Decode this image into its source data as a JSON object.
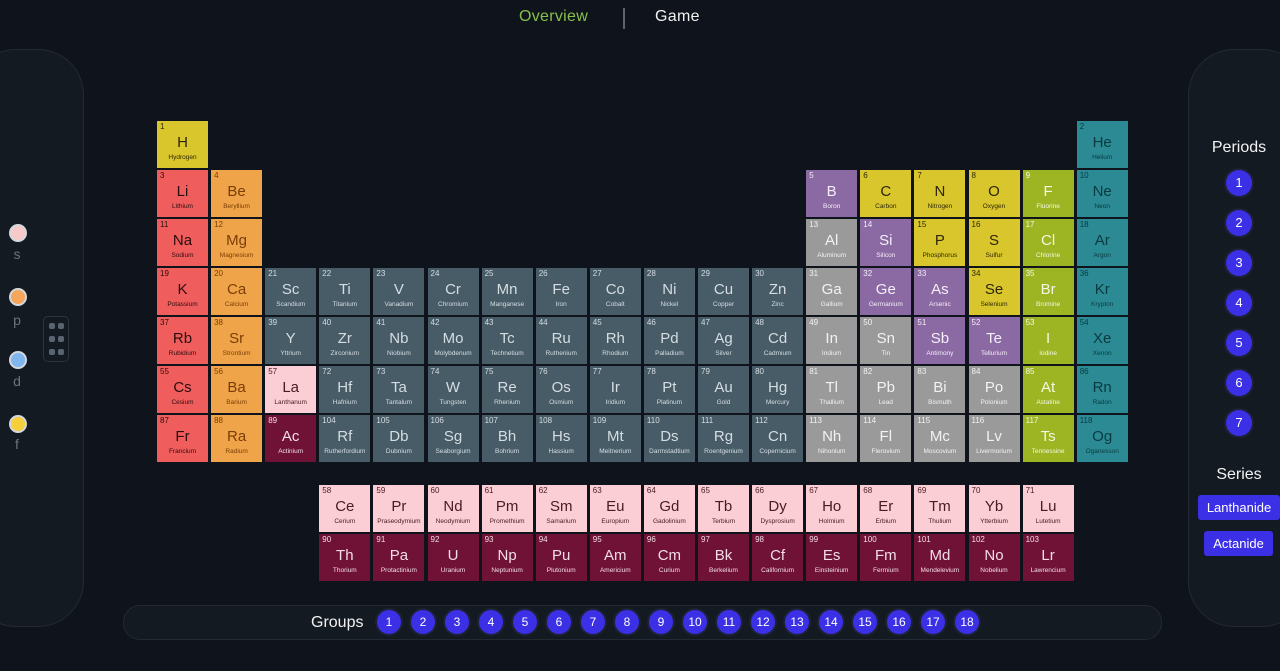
{
  "nav": {
    "overview": "Overview",
    "game": "Game"
  },
  "block_filters": [
    {
      "label": "s",
      "color": "#f7c9c9"
    },
    {
      "label": "p",
      "color": "#f5a65a"
    },
    {
      "label": "d",
      "color": "#7fb6ee"
    },
    {
      "label": "f",
      "color": "#f5cf3c"
    }
  ],
  "periods": {
    "title": "Periods",
    "items": [
      "1",
      "2",
      "3",
      "4",
      "5",
      "6",
      "7"
    ]
  },
  "series": {
    "title": "Series",
    "lanthanide": "Lanthanide",
    "actanide": "Actanide"
  },
  "groups": {
    "label": "Groups",
    "items": [
      "1",
      "2",
      "3",
      "4",
      "5",
      "6",
      "7",
      "8",
      "9",
      "10",
      "11",
      "12",
      "13",
      "14",
      "15",
      "16",
      "17",
      "18"
    ]
  },
  "categories": {
    "alkali": {
      "bg": "#f05d5d",
      "fg": "#2a0d0d"
    },
    "alkaline": {
      "bg": "#f0a44a",
      "fg": "#7a3d05"
    },
    "transition": {
      "bg": "#485c67",
      "fg": "#d5dde3"
    },
    "post": {
      "bg": "#9a9a9a",
      "fg": "#f2f2f2"
    },
    "metalloid": {
      "bg": "#8b6aa3",
      "fg": "#f5eef9"
    },
    "nonmetal": {
      "bg": "#d8c62c",
      "fg": "#2e2608"
    },
    "halogen": {
      "bg": "#9db423",
      "fg": "#f4f8e2"
    },
    "noble": {
      "bg": "#2b8a94",
      "fg": "#0a3a40"
    },
    "lanth": {
      "bg": "#fbcdd4",
      "fg": "#4a1a24"
    },
    "actin": {
      "bg": "#6f1236",
      "fg": "#f3dde6"
    }
  },
  "elements": [
    {
      "n": "1",
      "s": "H",
      "name": "Hydrogen",
      "c": "nonmetal"
    },
    {
      "n": "2",
      "s": "He",
      "name": "Helium",
      "c": "noble"
    },
    {
      "n": "3",
      "s": "Li",
      "name": "Lithium",
      "c": "alkali"
    },
    {
      "n": "4",
      "s": "Be",
      "name": "Beryllium",
      "c": "alkaline"
    },
    {
      "n": "5",
      "s": "B",
      "name": "Boron",
      "c": "metalloid"
    },
    {
      "n": "6",
      "s": "C",
      "name": "Carbon",
      "c": "nonmetal"
    },
    {
      "n": "7",
      "s": "N",
      "name": "Nitrogen",
      "c": "nonmetal"
    },
    {
      "n": "8",
      "s": "O",
      "name": "Oxygen",
      "c": "nonmetal"
    },
    {
      "n": "9",
      "s": "F",
      "name": "Fluorine",
      "c": "halogen"
    },
    {
      "n": "10",
      "s": "Ne",
      "name": "Neon",
      "c": "noble"
    },
    {
      "n": "11",
      "s": "Na",
      "name": "Sodium",
      "c": "alkali"
    },
    {
      "n": "12",
      "s": "Mg",
      "name": "Magnesium",
      "c": "alkaline"
    },
    {
      "n": "13",
      "s": "Al",
      "name": "Aluminum",
      "c": "post"
    },
    {
      "n": "14",
      "s": "Si",
      "name": "Silicon",
      "c": "metalloid"
    },
    {
      "n": "15",
      "s": "P",
      "name": "Phosphorus",
      "c": "nonmetal"
    },
    {
      "n": "16",
      "s": "S",
      "name": "Sulfur",
      "c": "nonmetal"
    },
    {
      "n": "17",
      "s": "Cl",
      "name": "Chlorine",
      "c": "halogen"
    },
    {
      "n": "18",
      "s": "Ar",
      "name": "Argon",
      "c": "noble"
    },
    {
      "n": "19",
      "s": "K",
      "name": "Potassium",
      "c": "alkali"
    },
    {
      "n": "20",
      "s": "Ca",
      "name": "Calcium",
      "c": "alkaline"
    },
    {
      "n": "21",
      "s": "Sc",
      "name": "Scandium",
      "c": "transition"
    },
    {
      "n": "22",
      "s": "Ti",
      "name": "Titanium",
      "c": "transition"
    },
    {
      "n": "23",
      "s": "V",
      "name": "Vanadium",
      "c": "transition"
    },
    {
      "n": "24",
      "s": "Cr",
      "name": "Chromium",
      "c": "transition"
    },
    {
      "n": "25",
      "s": "Mn",
      "name": "Manganese",
      "c": "transition"
    },
    {
      "n": "26",
      "s": "Fe",
      "name": "Iron",
      "c": "transition"
    },
    {
      "n": "27",
      "s": "Co",
      "name": "Cobalt",
      "c": "transition"
    },
    {
      "n": "28",
      "s": "Ni",
      "name": "Nickel",
      "c": "transition"
    },
    {
      "n": "29",
      "s": "Cu",
      "name": "Copper",
      "c": "transition"
    },
    {
      "n": "30",
      "s": "Zn",
      "name": "Zinc",
      "c": "transition"
    },
    {
      "n": "31",
      "s": "Ga",
      "name": "Gallium",
      "c": "post"
    },
    {
      "n": "32",
      "s": "Ge",
      "name": "Germanium",
      "c": "metalloid"
    },
    {
      "n": "33",
      "s": "As",
      "name": "Arsenic",
      "c": "metalloid"
    },
    {
      "n": "34",
      "s": "Se",
      "name": "Selenium",
      "c": "nonmetal"
    },
    {
      "n": "35",
      "s": "Br",
      "name": "Bromine",
      "c": "halogen"
    },
    {
      "n": "36",
      "s": "Kr",
      "name": "Krypton",
      "c": "noble"
    },
    {
      "n": "37",
      "s": "Rb",
      "name": "Rubidium",
      "c": "alkali"
    },
    {
      "n": "38",
      "s": "Sr",
      "name": "Strontium",
      "c": "alkaline"
    },
    {
      "n": "39",
      "s": "Y",
      "name": "Yttrium",
      "c": "transition"
    },
    {
      "n": "40",
      "s": "Zr",
      "name": "Zirconium",
      "c": "transition"
    },
    {
      "n": "41",
      "s": "Nb",
      "name": "Niobium",
      "c": "transition"
    },
    {
      "n": "42",
      "s": "Mo",
      "name": "Molybdenum",
      "c": "transition"
    },
    {
      "n": "43",
      "s": "Tc",
      "name": "Technetium",
      "c": "transition"
    },
    {
      "n": "44",
      "s": "Ru",
      "name": "Ruthenium",
      "c": "transition"
    },
    {
      "n": "45",
      "s": "Rh",
      "name": "Rhodium",
      "c": "transition"
    },
    {
      "n": "46",
      "s": "Pd",
      "name": "Palladium",
      "c": "transition"
    },
    {
      "n": "47",
      "s": "Ag",
      "name": "Silver",
      "c": "transition"
    },
    {
      "n": "48",
      "s": "Cd",
      "name": "Cadmium",
      "c": "transition"
    },
    {
      "n": "49",
      "s": "In",
      "name": "Indium",
      "c": "post"
    },
    {
      "n": "50",
      "s": "Sn",
      "name": "Tin",
      "c": "post"
    },
    {
      "n": "51",
      "s": "Sb",
      "name": "Antimony",
      "c": "metalloid"
    },
    {
      "n": "52",
      "s": "Te",
      "name": "Tellurium",
      "c": "metalloid"
    },
    {
      "n": "53",
      "s": "I",
      "name": "Iodine",
      "c": "halogen"
    },
    {
      "n": "54",
      "s": "Xe",
      "name": "Xenon",
      "c": "noble"
    },
    {
      "n": "55",
      "s": "Cs",
      "name": "Cesium",
      "c": "alkali"
    },
    {
      "n": "56",
      "s": "Ba",
      "name": "Barium",
      "c": "alkaline"
    },
    {
      "n": "57",
      "s": "La",
      "name": "Lanthanum",
      "c": "lanth"
    },
    {
      "n": "72",
      "s": "Hf",
      "name": "Hafnium",
      "c": "transition"
    },
    {
      "n": "73",
      "s": "Ta",
      "name": "Tantalum",
      "c": "transition"
    },
    {
      "n": "74",
      "s": "W",
      "name": "Tungsten",
      "c": "transition"
    },
    {
      "n": "75",
      "s": "Re",
      "name": "Rhenium",
      "c": "transition"
    },
    {
      "n": "76",
      "s": "Os",
      "name": "Osmium",
      "c": "transition"
    },
    {
      "n": "77",
      "s": "Ir",
      "name": "Iridium",
      "c": "transition"
    },
    {
      "n": "78",
      "s": "Pt",
      "name": "Platinum",
      "c": "transition"
    },
    {
      "n": "79",
      "s": "Au",
      "name": "Gold",
      "c": "transition"
    },
    {
      "n": "80",
      "s": "Hg",
      "name": "Mercury",
      "c": "transition"
    },
    {
      "n": "81",
      "s": "Tl",
      "name": "Thallium",
      "c": "post"
    },
    {
      "n": "82",
      "s": "Pb",
      "name": "Lead",
      "c": "post"
    },
    {
      "n": "83",
      "s": "Bi",
      "name": "Bismuth",
      "c": "post"
    },
    {
      "n": "84",
      "s": "Po",
      "name": "Polonium",
      "c": "post"
    },
    {
      "n": "85",
      "s": "At",
      "name": "Astatine",
      "c": "halogen"
    },
    {
      "n": "86",
      "s": "Rn",
      "name": "Radon",
      "c": "noble"
    },
    {
      "n": "87",
      "s": "Fr",
      "name": "Francium",
      "c": "alkali"
    },
    {
      "n": "88",
      "s": "Ra",
      "name": "Radium",
      "c": "alkaline"
    },
    {
      "n": "89",
      "s": "Ac",
      "name": "Actinium",
      "c": "actin"
    },
    {
      "n": "104",
      "s": "Rf",
      "name": "Rutherfordium",
      "c": "transition"
    },
    {
      "n": "105",
      "s": "Db",
      "name": "Dubnium",
      "c": "transition"
    },
    {
      "n": "106",
      "s": "Sg",
      "name": "Seaborgium",
      "c": "transition"
    },
    {
      "n": "107",
      "s": "Bh",
      "name": "Bohrium",
      "c": "transition"
    },
    {
      "n": "108",
      "s": "Hs",
      "name": "Hassium",
      "c": "transition"
    },
    {
      "n": "109",
      "s": "Mt",
      "name": "Meitnerium",
      "c": "transition"
    },
    {
      "n": "110",
      "s": "Ds",
      "name": "Darmstadtium",
      "c": "transition"
    },
    {
      "n": "111",
      "s": "Rg",
      "name": "Roentgenium",
      "c": "transition"
    },
    {
      "n": "112",
      "s": "Cn",
      "name": "Copernicium",
      "c": "transition"
    },
    {
      "n": "113",
      "s": "Nh",
      "name": "Nihonium",
      "c": "post"
    },
    {
      "n": "114",
      "s": "Fl",
      "name": "Flerovium",
      "c": "post"
    },
    {
      "n": "115",
      "s": "Mc",
      "name": "Moscovium",
      "c": "post"
    },
    {
      "n": "116",
      "s": "Lv",
      "name": "Livermorium",
      "c": "post"
    },
    {
      "n": "117",
      "s": "Ts",
      "name": "Tennessine",
      "c": "halogen"
    },
    {
      "n": "118",
      "s": "Og",
      "name": "Oganesson",
      "c": "noble"
    },
    {
      "n": "58",
      "s": "Ce",
      "name": "Cerium",
      "c": "lanth"
    },
    {
      "n": "59",
      "s": "Pr",
      "name": "Praseodymium",
      "c": "lanth"
    },
    {
      "n": "60",
      "s": "Nd",
      "name": "Neodymium",
      "c": "lanth"
    },
    {
      "n": "61",
      "s": "Pm",
      "name": "Promethium",
      "c": "lanth"
    },
    {
      "n": "62",
      "s": "Sm",
      "name": "Samarium",
      "c": "lanth"
    },
    {
      "n": "63",
      "s": "Eu",
      "name": "Europium",
      "c": "lanth"
    },
    {
      "n": "64",
      "s": "Gd",
      "name": "Gadolinium",
      "c": "lanth"
    },
    {
      "n": "65",
      "s": "Tb",
      "name": "Terbium",
      "c": "lanth"
    },
    {
      "n": "66",
      "s": "Dy",
      "name": "Dysprosium",
      "c": "lanth"
    },
    {
      "n": "67",
      "s": "Ho",
      "name": "Holmium",
      "c": "lanth"
    },
    {
      "n": "68",
      "s": "Er",
      "name": "Erbium",
      "c": "lanth"
    },
    {
      "n": "69",
      "s": "Tm",
      "name": "Thulium",
      "c": "lanth"
    },
    {
      "n": "70",
      "s": "Yb",
      "name": "Ytterbium",
      "c": "lanth"
    },
    {
      "n": "71",
      "s": "Lu",
      "name": "Lutetium",
      "c": "lanth"
    },
    {
      "n": "90",
      "s": "Th",
      "name": "Thorium",
      "c": "actin"
    },
    {
      "n": "91",
      "s": "Pa",
      "name": "Protactinium",
      "c": "actin"
    },
    {
      "n": "92",
      "s": "U",
      "name": "Uranium",
      "c": "actin"
    },
    {
      "n": "93",
      "s": "Np",
      "name": "Neptunium",
      "c": "actin"
    },
    {
      "n": "94",
      "s": "Pu",
      "name": "Plutonium",
      "c": "actin"
    },
    {
      "n": "95",
      "s": "Am",
      "name": "Americium",
      "c": "actin"
    },
    {
      "n": "96",
      "s": "Cm",
      "name": "Curium",
      "c": "actin"
    },
    {
      "n": "97",
      "s": "Bk",
      "name": "Berkelium",
      "c": "actin"
    },
    {
      "n": "98",
      "s": "Cf",
      "name": "Californium",
      "c": "actin"
    },
    {
      "n": "99",
      "s": "Es",
      "name": "Einsteinium",
      "c": "actin"
    },
    {
      "n": "100",
      "s": "Fm",
      "name": "Fermium",
      "c": "actin"
    },
    {
      "n": "101",
      "s": "Md",
      "name": "Mendelevium",
      "c": "actin"
    },
    {
      "n": "102",
      "s": "No",
      "name": "Nobelium",
      "c": "actin"
    },
    {
      "n": "103",
      "s": "Lr",
      "name": "Lawrencium",
      "c": "actin"
    }
  ]
}
